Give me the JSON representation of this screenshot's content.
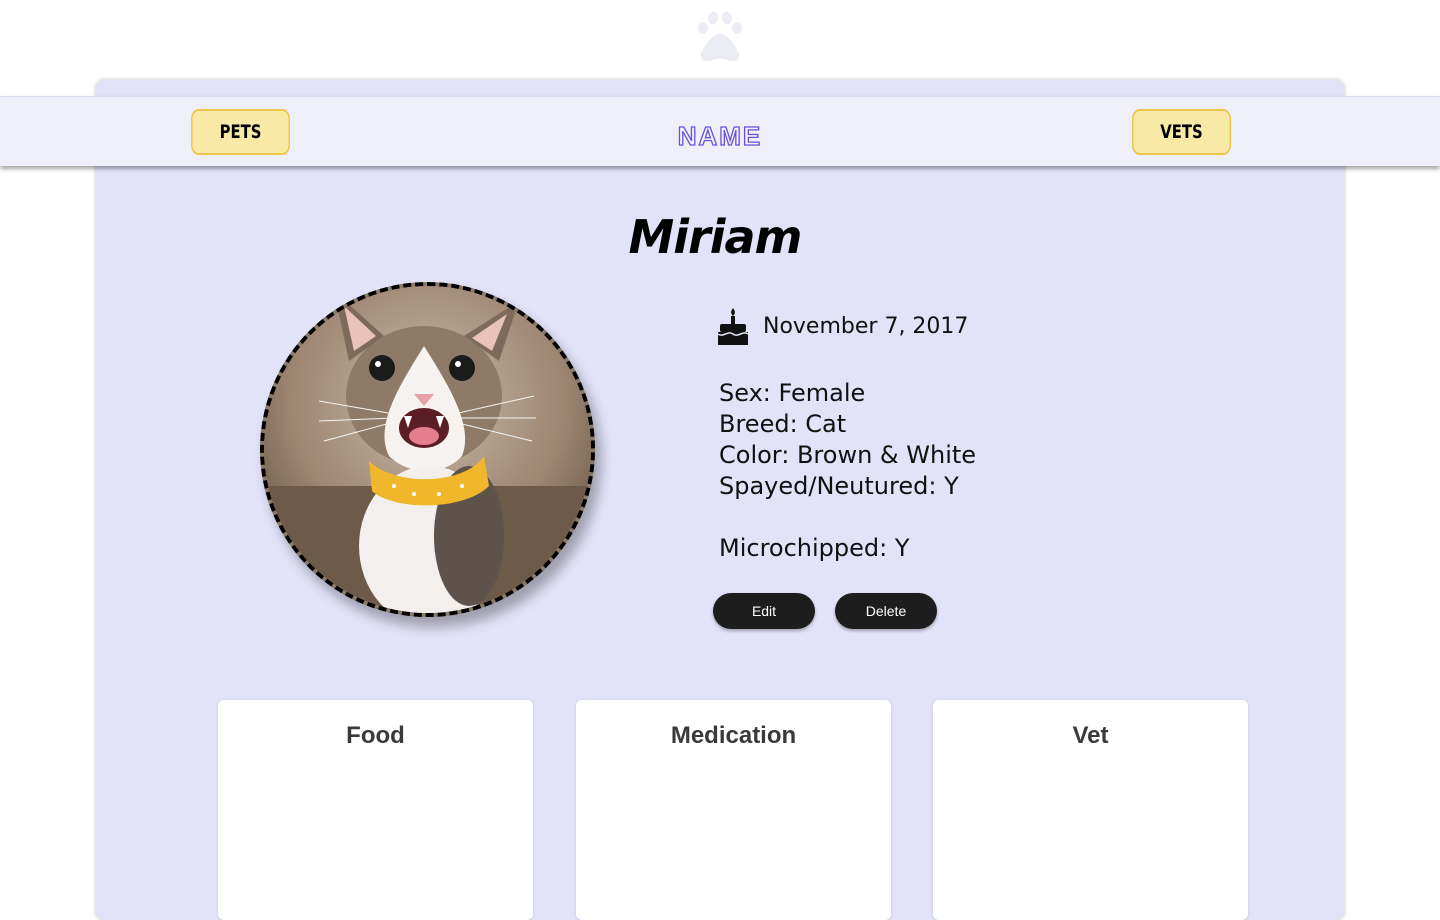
{
  "header": {
    "logo_icon": "paw-icon",
    "brand_text": "NAME",
    "nav": [
      {
        "label": "PETS"
      },
      {
        "label": "VETS"
      }
    ]
  },
  "pet": {
    "name": "Miriam",
    "photo_icon": "cat-photo",
    "birthday_icon": "birthday-cake-icon",
    "birthday": "November 7, 2017",
    "sex": "Sex: Female",
    "breed": "Breed: Cat",
    "color": "Color: Brown & White",
    "spayed": "Spayed/Neutured: Y",
    "microchipped": "Microchipped: Y"
  },
  "actions": {
    "edit_label": "Edit",
    "delete_label": "Delete"
  },
  "cards": [
    {
      "title": "Food"
    },
    {
      "title": "Medication"
    },
    {
      "title": "Vet"
    }
  ],
  "colors": {
    "panel_bg": "#e2e2f9",
    "nav_bg": "#efeffa",
    "nav_button_bg": "#f8eaa6",
    "nav_button_border": "#f0c64a",
    "brand_accent": "#6a4fd9",
    "action_button_bg": "#1d1d1d"
  }
}
